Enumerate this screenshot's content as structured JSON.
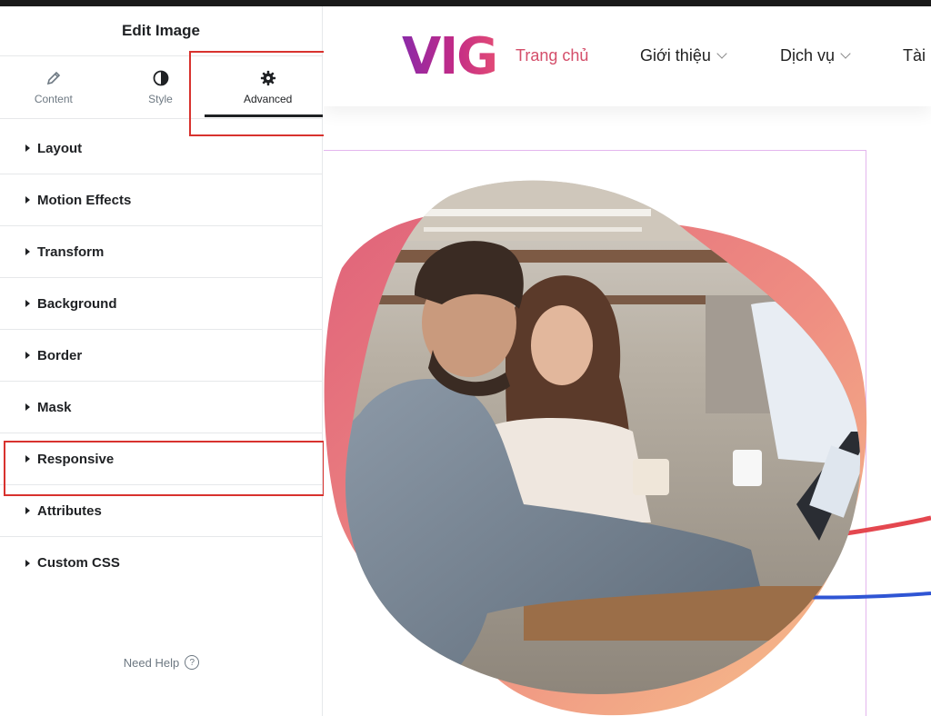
{
  "panel": {
    "title": "Edit Image",
    "tabs": [
      {
        "label": "Content",
        "icon": "pencil-icon"
      },
      {
        "label": "Style",
        "icon": "half-circle-icon"
      },
      {
        "label": "Advanced",
        "icon": "gear-icon",
        "active": true
      }
    ],
    "sections": [
      "Layout",
      "Motion Effects",
      "Transform",
      "Background",
      "Border",
      "Mask",
      "Responsive",
      "Attributes",
      "Custom CSS"
    ],
    "need_help": "Need Help",
    "highlight_color": "#d8322e"
  },
  "site": {
    "logo": "VIG",
    "nav": [
      {
        "label": "Trang chủ",
        "current": true
      },
      {
        "label": "Giới thiệu",
        "dropdown": true
      },
      {
        "label": "Dịch vụ",
        "dropdown": true
      },
      {
        "label": "Tài"
      }
    ],
    "accent": "#d44e6a"
  }
}
